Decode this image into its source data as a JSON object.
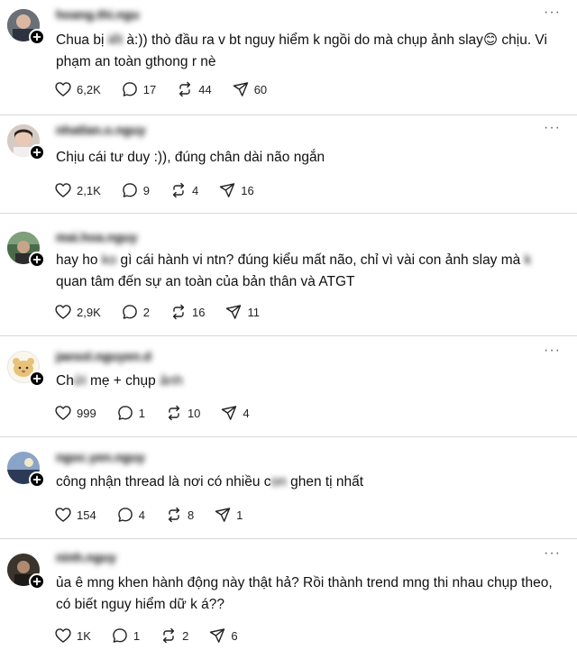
{
  "posts": [
    {
      "username": "hoang.thi.ngu",
      "text_parts": [
        "Chua bị ",
        "iết",
        " à:)) thò đầu ra v bt nguy hiểm k ngồi do mà chụp ảnh slay",
        "😊",
        " chịu. Vi phạm an toàn gthong r nè"
      ],
      "likes": "6,2K",
      "replies": "17",
      "reposts": "44",
      "shares": "60"
    },
    {
      "username": "nhatlan.o.nguy",
      "text_parts": [
        "Chịu cái tư duy :)), đúng chân dài não ngắn"
      ],
      "likes": "2,1K",
      "replies": "9",
      "reposts": "4",
      "shares": "16"
    },
    {
      "username": "mai.hoa.nguy",
      "text_parts": [
        "hay ho ",
        "ko",
        " gì cái hành vi ntn? đúng kiểu mất não, chỉ vì vài con ảnh slay mà ",
        "k",
        " quan tâm đến sự an toàn của bản thân và ATGT"
      ],
      "likes": "2,9K",
      "replies": "2",
      "reposts": "16",
      "shares": "11"
    },
    {
      "username": "jaesol.nguyen.d",
      "text_parts": [
        "Ch",
        "ửi",
        " mẹ + chụp ",
        "ảnh"
      ],
      "likes": "999",
      "replies": "1",
      "reposts": "10",
      "shares": "4"
    },
    {
      "username": "ngoc.yen.nguy",
      "text_parts": [
        "công nhận thread là nơi có nhiều c",
        "on",
        " ghen tị nhất"
      ],
      "likes": "154",
      "replies": "4",
      "reposts": "8",
      "shares": "1"
    },
    {
      "username": "ninh.nguy",
      "text_parts": [
        "ủa ê mng khen hành động này thật hả? Rồi thành trend mng thi nhau chụp theo, có biết nguy hiểm dữ k á??"
      ],
      "likes": "1K",
      "replies": "1",
      "reposts": "2",
      "shares": "6"
    }
  ],
  "icons": {
    "like": "heart-icon",
    "reply": "comment-icon",
    "repost": "repost-icon",
    "share": "share-icon",
    "more": "more-icon",
    "follow": "plus-icon"
  },
  "more_label": "···"
}
